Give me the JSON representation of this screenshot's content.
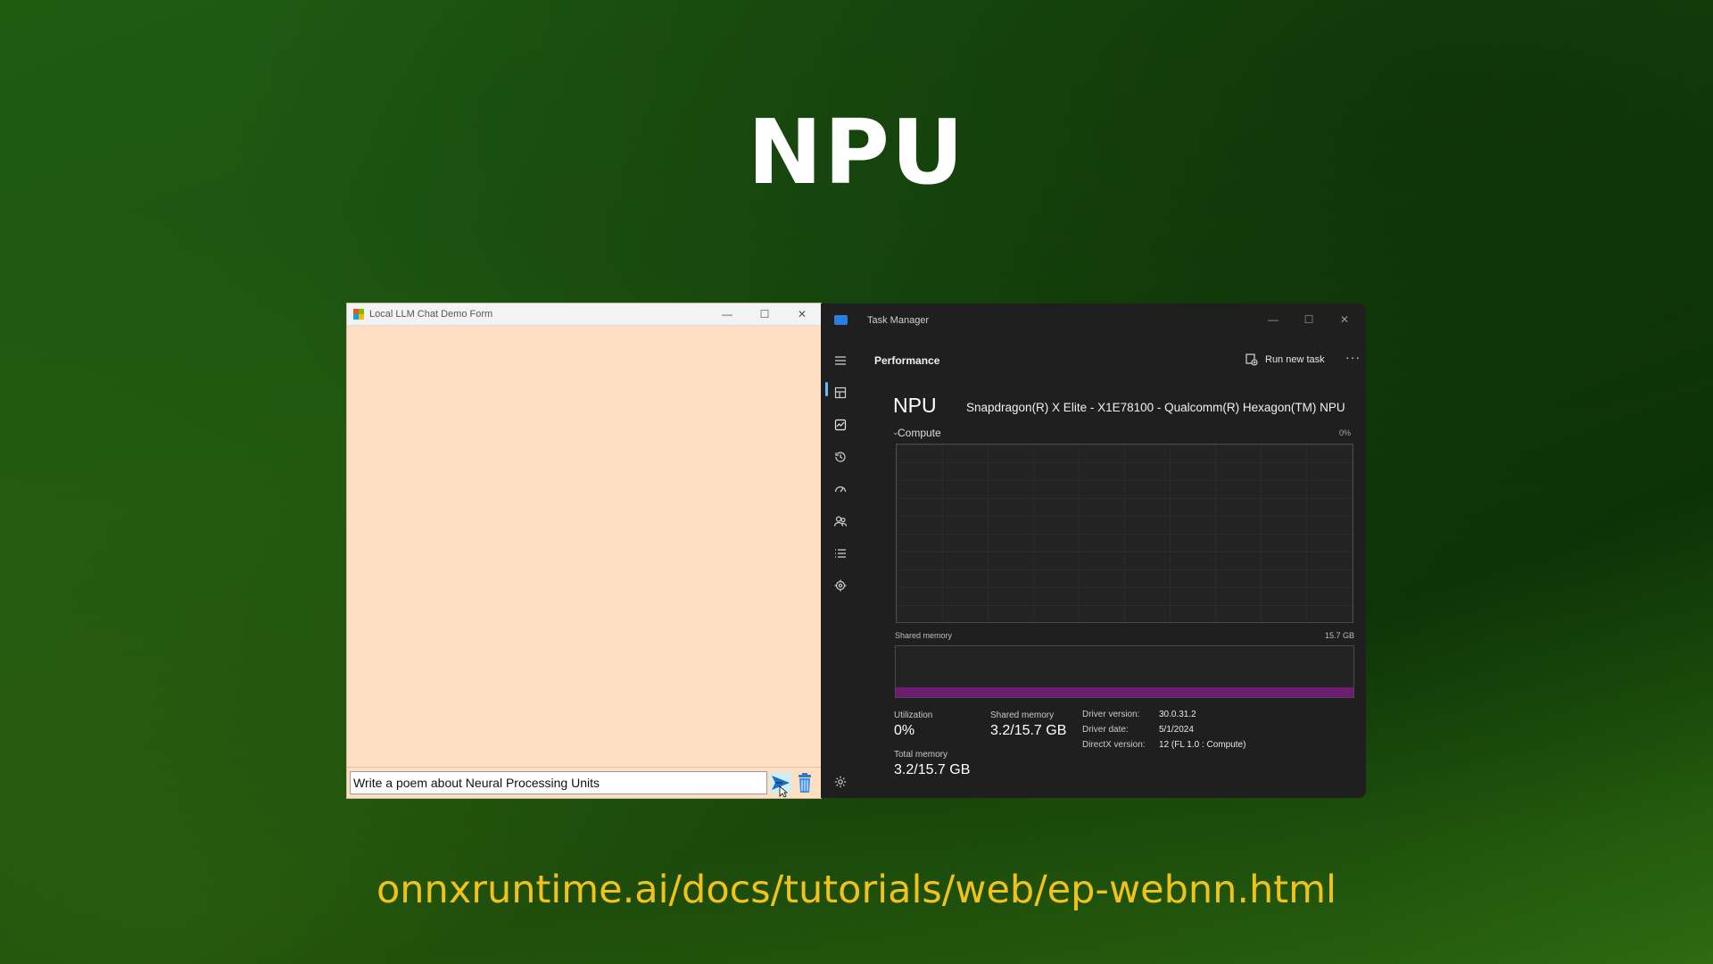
{
  "slide": {
    "title": "NPU",
    "url": "onnxruntime.ai/docs/tutorials/web/ep-webnn.html"
  },
  "chat_window": {
    "title": "Local LLM Chat Demo Form",
    "controls": {
      "minimize": "—",
      "maximize": "☐",
      "close": "✕"
    },
    "input_value": "Write a poem about Neural Processing Units",
    "colors": {
      "background": "#ffdfc2"
    }
  },
  "task_manager": {
    "title": "Task Manager",
    "controls": {
      "minimize": "—",
      "maximize": "☐",
      "close": "✕"
    },
    "page_title": "Performance",
    "run_new_task": "Run new task",
    "more": "···",
    "nav_icons": [
      "menu-icon",
      "processes-icon",
      "performance-icon",
      "app-history-icon",
      "startup-apps-icon",
      "users-icon",
      "details-icon",
      "services-icon",
      "settings-icon"
    ],
    "device_heading": "NPU",
    "device_name": "Snapdragon(R) X Elite - X1E78100 - Qualcomm(R) Hexagon(TM) NPU",
    "compute": {
      "label": "Compute",
      "chevron": "⌄",
      "max_label": "0%",
      "utilization_percent": 0
    },
    "shared_memory": {
      "label": "Shared memory",
      "total": "15.7 GB",
      "used_gb": 3.2,
      "total_gb": 15.7
    },
    "stats": {
      "utilization_label": "Utilization",
      "utilization_value": "0%",
      "shared_memory_label": "Shared memory",
      "shared_memory_value": "3.2/15.7 GB",
      "total_memory_label": "Total memory",
      "total_memory_value": "3.2/15.7 GB"
    },
    "driver": {
      "version_label": "Driver version:",
      "version_value": "30.0.31.2",
      "date_label": "Driver date:",
      "date_value": "5/1/2024",
      "directx_label": "DirectX version:",
      "directx_value": "12 (FL 1.0 : Compute)"
    },
    "colors": {
      "background": "#1f1f1f",
      "memory_fill": "#6e1c6f",
      "accent": "#6cb8f6"
    }
  }
}
